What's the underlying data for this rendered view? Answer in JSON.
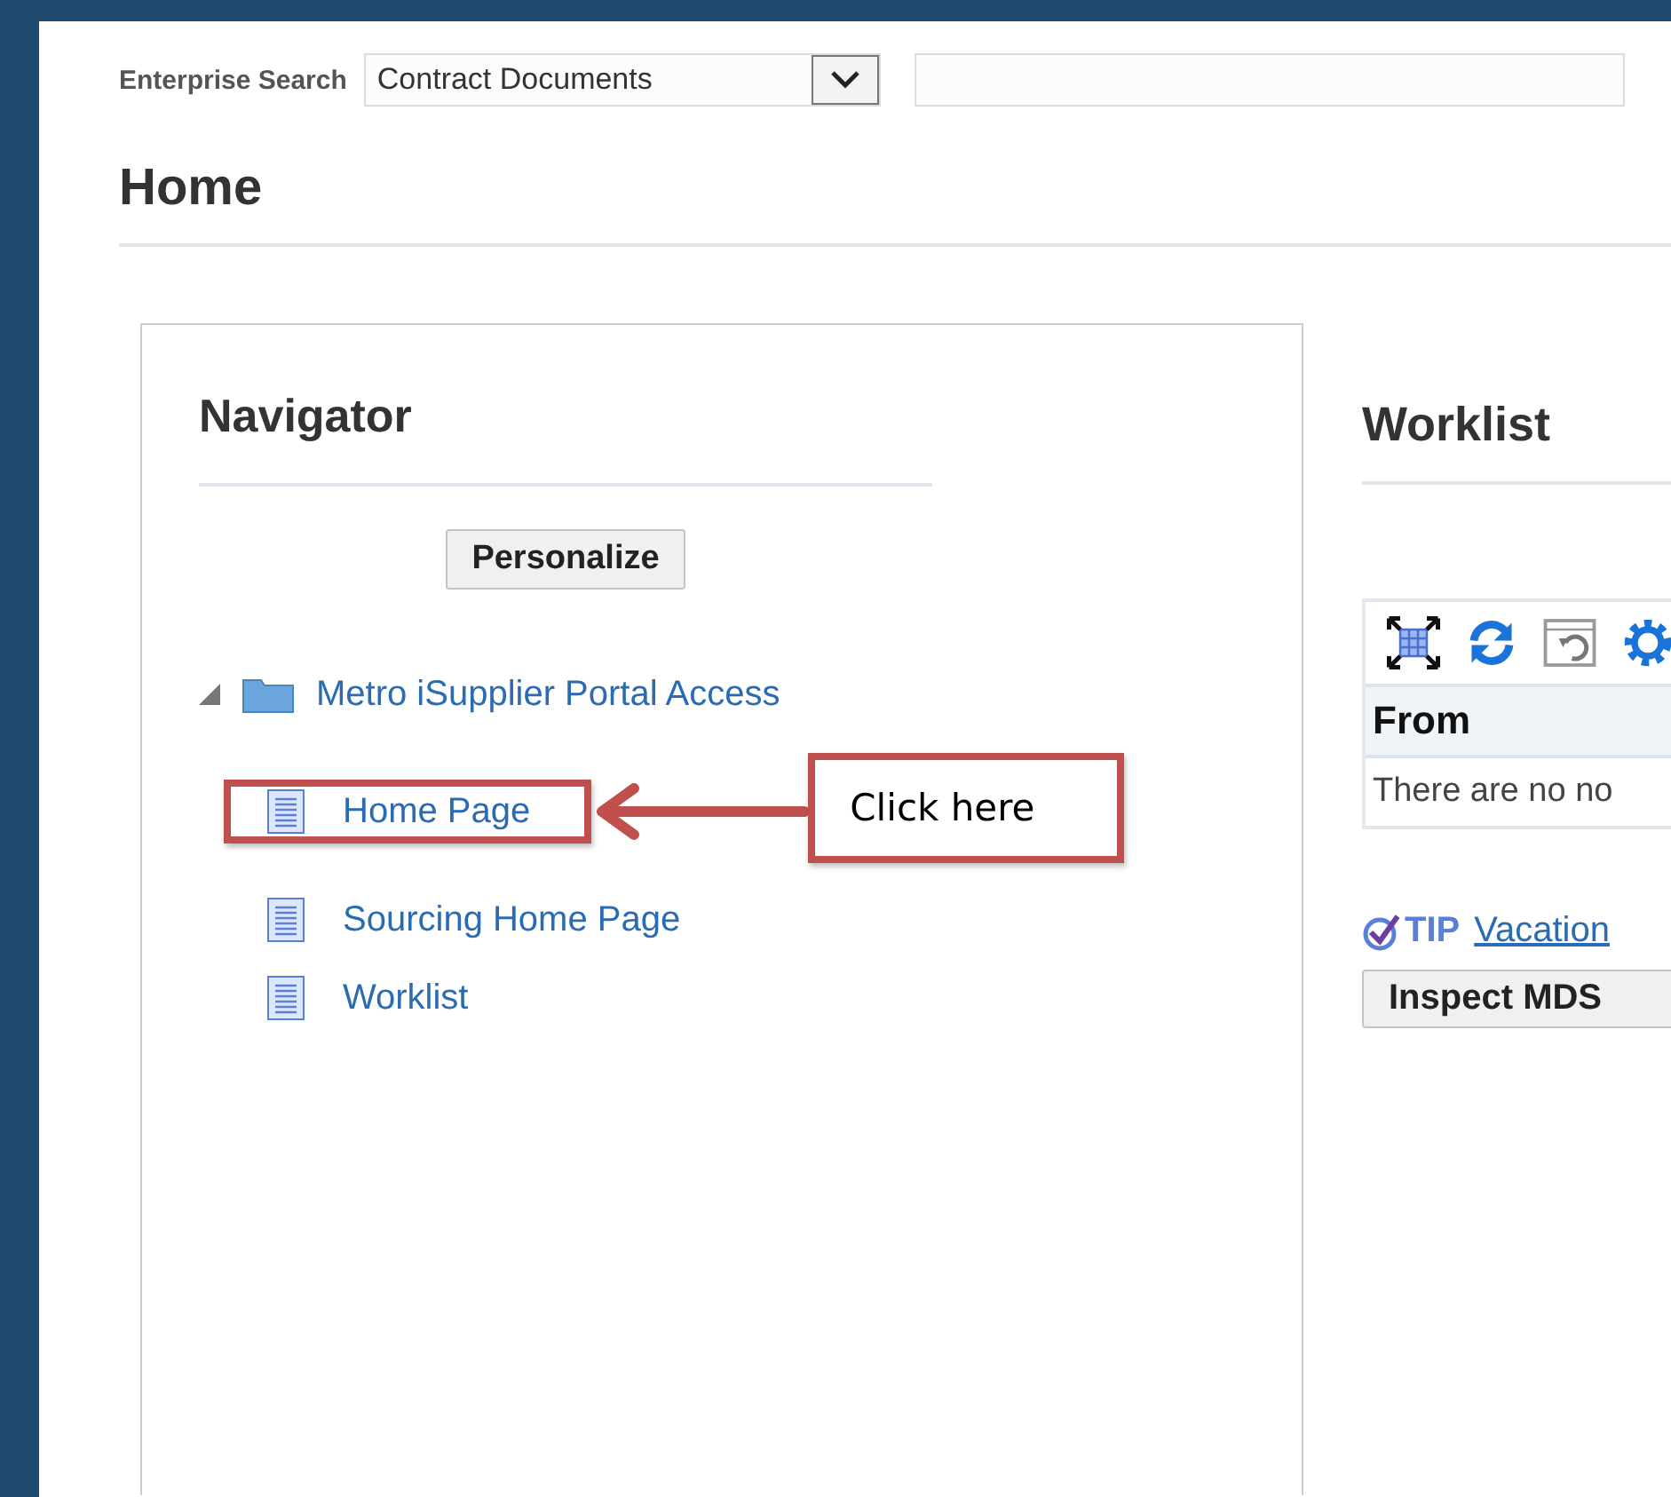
{
  "search": {
    "label": "Enterprise Search",
    "category": "Contract Documents"
  },
  "page_title": "Home",
  "navigator": {
    "title": "Navigator",
    "personalize_button": "Personalize",
    "tree": [
      {
        "label": "Metro iSupplier Portal Access",
        "expanded": true,
        "children": [
          {
            "label": "Home Page",
            "highlighted": true
          },
          {
            "label": "Sourcing Home Page",
            "highlighted": false
          },
          {
            "label": "Worklist",
            "highlighted": false
          }
        ]
      }
    ]
  },
  "callout": {
    "text": "Click here"
  },
  "worklist": {
    "title": "Worklist",
    "columns": [
      "From"
    ],
    "empty_message": "There are no no",
    "tip_label": "TIP",
    "tip_link": "Vacation",
    "inspect_button": "Inspect MDS"
  }
}
